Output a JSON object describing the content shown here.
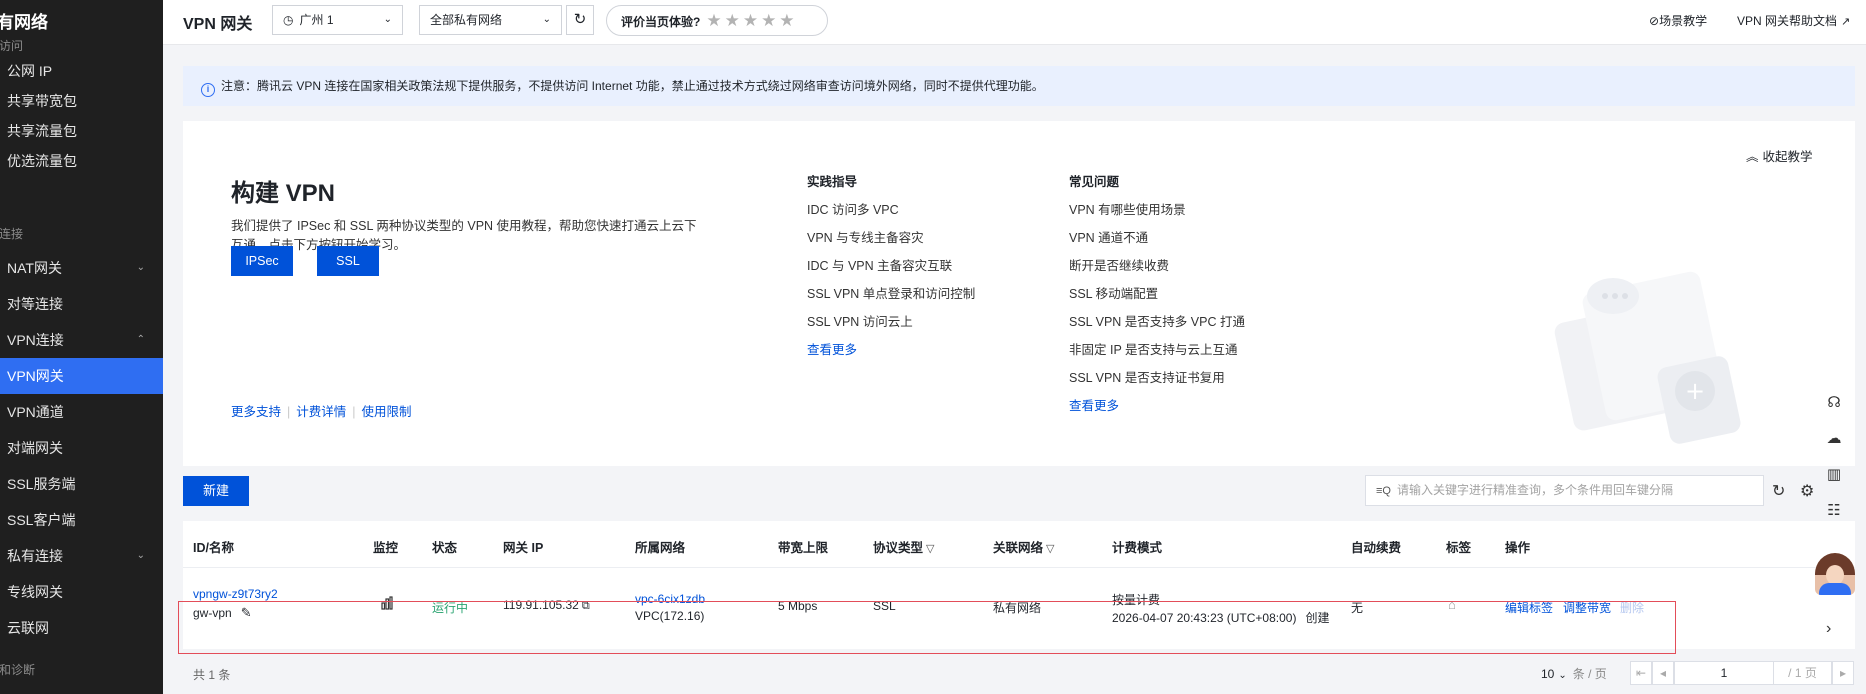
{
  "sidebar": {
    "title": "有网络",
    "group_access": "访问",
    "items_a": [
      "公网 IP",
      "共享带宽包",
      "共享流量包",
      "优选流量包"
    ],
    "group_connect": "连接",
    "items_b": [
      {
        "label": "NAT网关",
        "chevron": "⌄"
      },
      {
        "label": "对等连接",
        "chevron": ""
      },
      {
        "label": "VPN连接",
        "chevron": "⌃"
      },
      {
        "label": "VPN网关",
        "chevron": ""
      },
      {
        "label": "VPN通道",
        "chevron": ""
      },
      {
        "label": "对端网关",
        "chevron": ""
      },
      {
        "label": "SSL服务端",
        "chevron": ""
      },
      {
        "label": "SSL客户端",
        "chevron": ""
      },
      {
        "label": "私有连接",
        "chevron": "⌄"
      },
      {
        "label": "专线网关",
        "chevron": ""
      },
      {
        "label": "云联网",
        "chevron": ""
      }
    ],
    "group_diag": "和诊断",
    "active_item": "VPN网关"
  },
  "topbar": {
    "title": "VPN 网关",
    "region": "广州 1",
    "network": "全部私有网络",
    "rate_label": "评价当页体验?",
    "stars": "★★★★★",
    "scene_link": "场景教学",
    "help_link": "VPN 网关帮助文档"
  },
  "notice": {
    "text": "注意：腾讯云 VPN 连接在国家相关政策法规下提供服务，不提供访问 Internet 功能，禁止通过技术方式绕过网络审查访问境外网络，同时不提供代理功能。"
  },
  "tutorial": {
    "title": "构建 VPN",
    "desc": "我们提供了 IPSec 和 SSL 两种协议类型的 VPN 使用教程，帮助您快速打通云上云下互通，点击下方按钮开始学习。",
    "btn_ipsec": "IPSec",
    "btn_ssl": "SSL",
    "links": [
      "更多支持",
      "计费详情",
      "使用限制"
    ],
    "collapse": "收起教学",
    "practice": {
      "head": "实践指导",
      "items": [
        "IDC 访问多 VPC",
        "VPN 与专线主备容灾",
        "IDC 与 VPN 主备容灾互联",
        "SSL VPN 单点登录和访问控制",
        "SSL VPN 访问云上"
      ],
      "more": "查看更多"
    },
    "faq": {
      "head": "常见问题",
      "items": [
        "VPN 有哪些使用场景",
        "VPN 通道不通",
        "断开是否继续收费",
        "SSL 移动端配置",
        "SSL VPN 是否支持多 VPC 打通",
        "非固定 IP 是否支持与云上互通",
        "SSL VPN 是否支持证书复用"
      ],
      "more": "查看更多"
    }
  },
  "toolbar": {
    "new_label": "新建",
    "search_placeholder": "请输入关键字进行精准查询，多个条件用回车键分隔"
  },
  "table": {
    "columns": [
      "ID/名称",
      "监控",
      "状态",
      "网关 IP",
      "所属网络",
      "带宽上限",
      "协议类型",
      "关联网络",
      "计费模式",
      "自动续费",
      "标签",
      "操作"
    ],
    "rows": [
      {
        "id": "vpngw-z9t73ry2",
        "name": "gw-vpn",
        "status": "运行中",
        "ip": "119.91.105.32",
        "vpc_id": "vpc-6cix1zdb",
        "vpc_name": "VPC(172.16)",
        "bandwidth": "5 Mbps",
        "protocol": "SSL",
        "assoc": "私有网络",
        "billing": "按量计费",
        "created": "2026-04-07 20:43:23 (UTC+08:00)",
        "created_suffix": "创建",
        "autorenew": "无",
        "actions": [
          "编辑标签",
          "调整带宽",
          "删除"
        ]
      }
    ]
  },
  "footer": {
    "total": "共 1 条",
    "page_size": "10",
    "page_size_unit": "条 / 页",
    "page": "1",
    "pages": "/ 1 页"
  }
}
